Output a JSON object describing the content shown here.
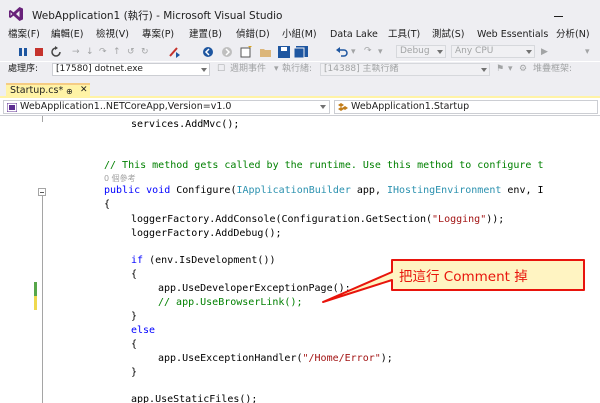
{
  "window": {
    "title": "WebApplication1 (執行) - Microsoft Visual Studio"
  },
  "menu": {
    "items": [
      "檔案(F)",
      "編輯(E)",
      "檢視(V)",
      "專案(P)",
      "建置(B)",
      "偵錯(D)",
      "小組(M)",
      "Data Lake",
      "工具(T)",
      "測試(S)",
      "Web Essentials",
      "分析(N)"
    ]
  },
  "toolbar": {
    "config": "Debug",
    "platform": "Any CPU"
  },
  "debug_bar": {
    "process_label": "處理序:",
    "process_value": "[17580] dotnet.exe",
    "lifecycle_label": "週期事件",
    "thread_label": "執行緒:",
    "thread_value": "[14388] 主執行緒",
    "stack_label": "堆疊框架:"
  },
  "tabs": [
    {
      "label": "Startup.cs*",
      "active": true,
      "pin_icon": "pin-icon",
      "close_icon": "close-icon"
    }
  ],
  "navigation": {
    "project_combo": "WebApplication1..NETCoreApp,Version=v1.0",
    "class_combo": "WebApplication1.Startup"
  },
  "code": {
    "line1": "services.AddMvc();",
    "line2_comment": "// This method gets called by the runtime. Use this method to configure t",
    "line3_refs": "0 個參考",
    "line4_kw1": "public",
    "line4_kw2": "void",
    "line4_name": " Configure(",
    "line4_type1": "IApplicationBuilder",
    "line4_mid": " app, ",
    "line4_type2": "IHostingEnvironment",
    "line4_tail": " env, I",
    "line5": "{",
    "line6_head": "loggerFactory.AddConsole(Configuration.GetSection(",
    "line6_str": "\"Logging\"",
    "line6_tail": "));",
    "line7": "loggerFactory.AddDebug();",
    "line8_kw": "if",
    "line8_tail": " (env.IsDevelopment())",
    "line9": "{",
    "line10": "app.UseDeveloperExceptionPage();",
    "line11_comment": "// app.UseBrowserLink();",
    "line12": "}",
    "line13_kw": "else",
    "line14": "{",
    "line15_head": "app.UseExceptionHandler(",
    "line15_str": "\"/Home/Error\"",
    "line15_tail": ");",
    "line16": "}",
    "line17": "app.UseStaticFiles();"
  },
  "annotation": {
    "text": "把這行 Comment 掉",
    "color": "#e8140c"
  },
  "colors": {
    "keyword": "#0000ff",
    "type": "#2b91af",
    "comment": "#008000",
    "string": "#a31515",
    "saved_change": "#57a64a",
    "unsaved_change": "#efd94e",
    "active_tab": "#fff3a6"
  }
}
